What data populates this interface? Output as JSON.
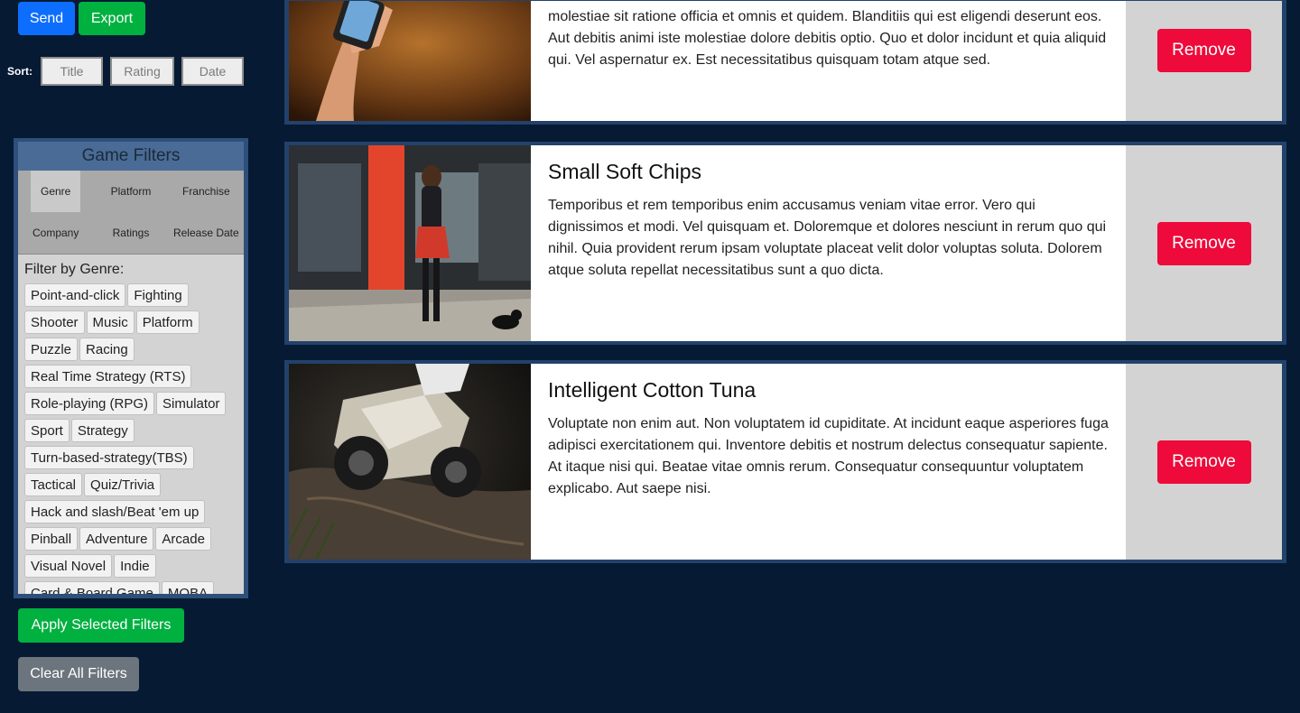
{
  "toolbar": {
    "send_label": "Send",
    "export_label": "Export"
  },
  "sort": {
    "label": "Sort:",
    "options": [
      "Title",
      "Rating",
      "Date"
    ]
  },
  "filters": {
    "header": "Game Filters",
    "tabs": [
      "Genre",
      "Platform",
      "Franchise",
      "Company",
      "Ratings",
      "Release Date"
    ],
    "active_tab": "Genre",
    "filter_by_label": "Filter by Genre:",
    "genres": [
      "Point-and-click",
      "Fighting",
      "Shooter",
      "Music",
      "Platform",
      "Puzzle",
      "Racing",
      "Real Time Strategy (RTS)",
      "Role-playing (RPG)",
      "Simulator",
      "Sport",
      "Strategy",
      "Turn-based-strategy(TBS)",
      "Tactical",
      "Quiz/Trivia",
      "Hack and slash/Beat 'em up",
      "Pinball",
      "Adventure",
      "Arcade",
      "Visual Novel",
      "Indie",
      "Card & Board Game",
      "MOBA"
    ],
    "apply_label": "Apply Selected Filters",
    "clear_label": "Clear All Filters"
  },
  "cards": [
    {
      "title": "",
      "description": "molestiae sit ratione officia et omnis et quidem. Blanditiis qui est eligendi deserunt eos. Aut debitis animi iste molestiae dolore debitis optio. Quo et dolor incidunt et quia aliquid qui. Vel aspernatur ex. Est necessitatibus quisquam totam atque sed.",
      "remove_label": "Remove"
    },
    {
      "title": "Small Soft Chips",
      "description": "Temporibus et rem temporibus enim accusamus veniam vitae error. Vero qui dignissimos et modi. Vel quisquam et. Doloremque et dolores nesciunt in rerum quo qui nihil. Quia provident rerum ipsam voluptate placeat velit dolor voluptas soluta. Dolorem atque soluta repellat necessitatibus sunt a quo dicta.",
      "remove_label": "Remove"
    },
    {
      "title": "Intelligent Cotton Tuna",
      "description": "Voluptate non enim aut. Non voluptatem id cupiditate. At incidunt eaque asperiores fuga adipisci exercitationem qui. Inventore debitis et nostrum delectus consequatur sapiente. At itaque nisi qui. Beatae vitae omnis rerum. Consequatur consequuntur voluptatem explicabo. Aut saepe nisi.",
      "remove_label": "Remove"
    }
  ]
}
